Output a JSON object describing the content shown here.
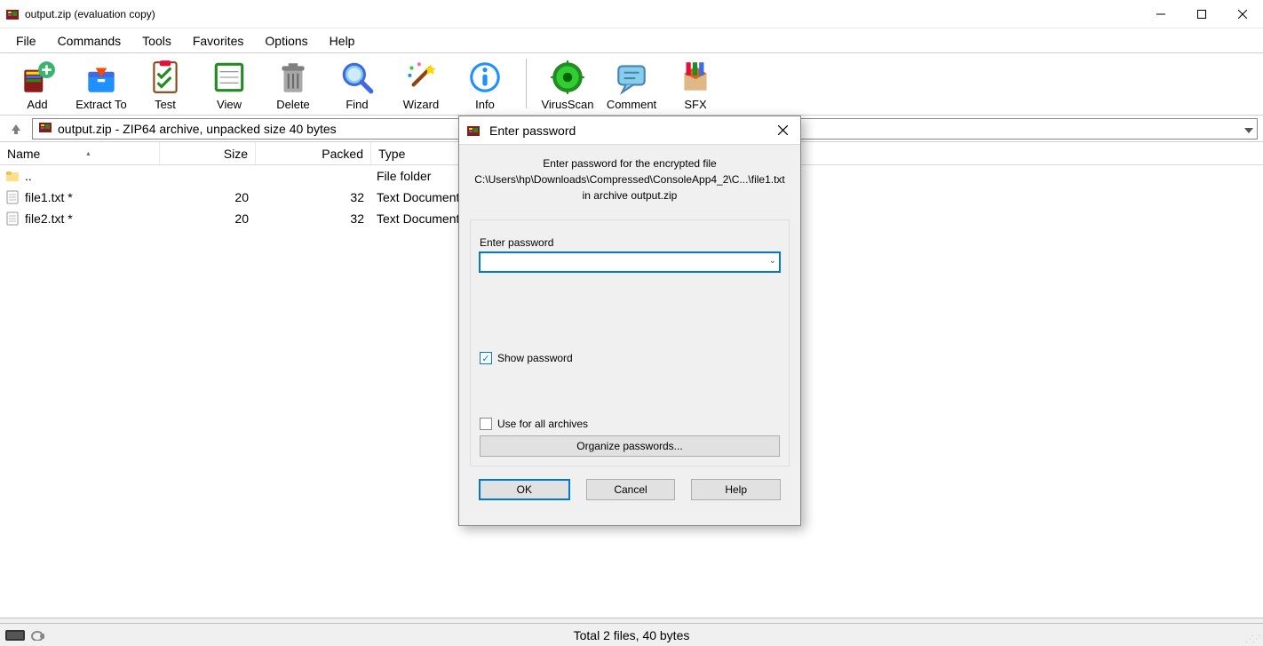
{
  "window": {
    "title": "output.zip (evaluation copy)"
  },
  "menu": {
    "file": "File",
    "commands": "Commands",
    "tools": "Tools",
    "favorites": "Favorites",
    "options": "Options",
    "help": "Help"
  },
  "toolbar": {
    "add": "Add",
    "extract": "Extract To",
    "test": "Test",
    "view": "View",
    "delete": "Delete",
    "find": "Find",
    "wizard": "Wizard",
    "info": "Info",
    "virusscan": "VirusScan",
    "comment": "Comment",
    "sfx": "SFX"
  },
  "address": {
    "path": "output.zip - ZIP64 archive, unpacked size 40 bytes"
  },
  "columns": {
    "name": "Name",
    "size": "Size",
    "packed": "Packed",
    "type": "Type"
  },
  "rows": [
    {
      "name": "..",
      "size": "",
      "packed": "",
      "type": "File folder",
      "icon": "folder"
    },
    {
      "name": "file1.txt *",
      "size": "20",
      "packed": "32",
      "type": "Text Document",
      "icon": "file"
    },
    {
      "name": "file2.txt *",
      "size": "20",
      "packed": "32",
      "type": "Text Document",
      "icon": "file"
    }
  ],
  "status": {
    "total": "Total 2 files, 40 bytes"
  },
  "dialog": {
    "title": "Enter password",
    "message_line1": "Enter password for the encrypted file",
    "message_line2": "C:\\Users\\hp\\Downloads\\Compressed\\ConsoleApp4_2\\C...\\file1.txt",
    "message_line3": "in archive output.zip",
    "enter_password_label": "Enter password",
    "password_value": "",
    "show_password": "Show password",
    "use_for_all": "Use for all archives",
    "organize": "Organize passwords...",
    "ok": "OK",
    "cancel": "Cancel",
    "help": "Help"
  }
}
